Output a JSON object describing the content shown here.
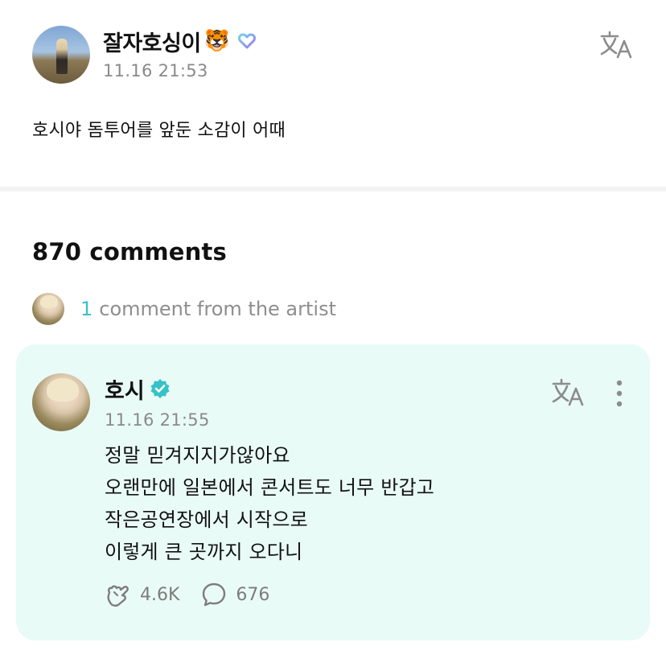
{
  "post": {
    "author": "잘자호싱이",
    "author_emoji": "🐯",
    "time": "11.16 21:53",
    "body": "호시야 돔투어를 앞둔 소감이 어때"
  },
  "comments": {
    "count_label": "870 comments",
    "artist_count": "1",
    "artist_label": "comment from the artist"
  },
  "artist_comment": {
    "author": "호시",
    "time": "11.16 21:55",
    "lines": [
      "정말 믿겨지지가않아요",
      "오랜만에 일본에서 콘서트도 너무 반갑고",
      "작은공연장에서 시작으로",
      "이렇게 큰 곳까지 오다니"
    ],
    "likes": "4.6K",
    "replies": "676"
  },
  "colors": {
    "accent": "#37c2c7",
    "card_bg": "#e9fbf6",
    "muted": "#8a8a8a"
  },
  "icons": [
    "translate-icon",
    "membership-icon",
    "verified-icon",
    "more-icon",
    "like-icon",
    "reply-icon"
  ]
}
